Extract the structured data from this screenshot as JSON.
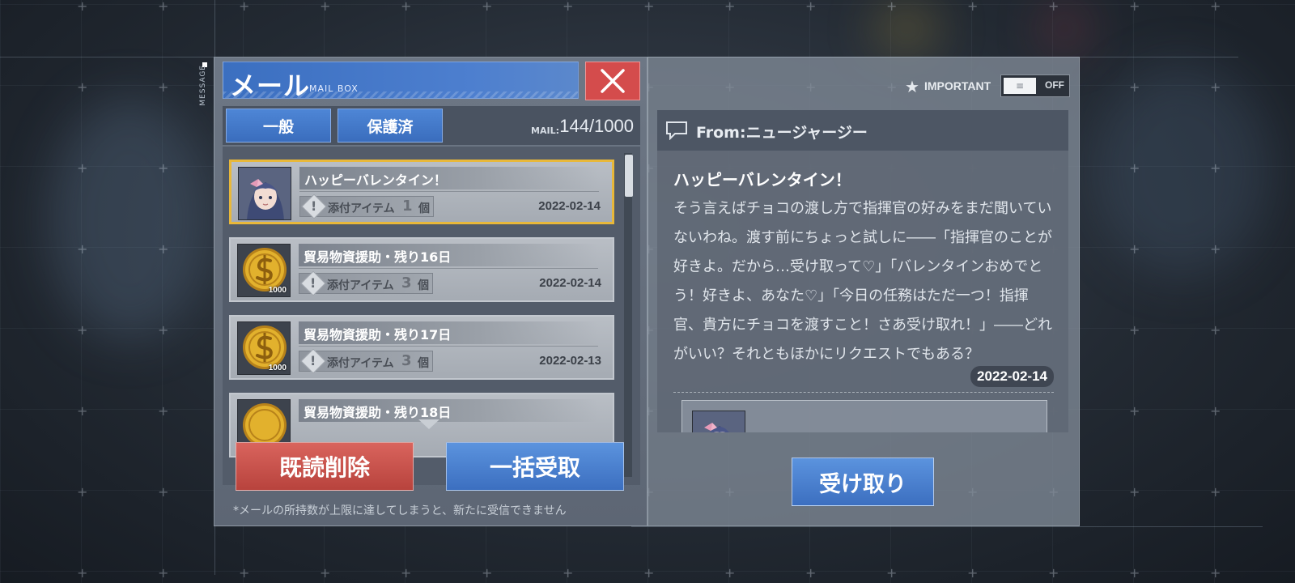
{
  "mailbox": {
    "side_label": "MESSAGE",
    "title": "メール",
    "subtitle": "MAIL BOX",
    "tabs": [
      {
        "label": "一般"
      },
      {
        "label": "保護済"
      }
    ],
    "mail_count_label": "MAIL:",
    "mail_count": "144/1000",
    "items": [
      {
        "title": "ハッピーバレンタイン！",
        "attach_label": "添付アイテム",
        "attach_count": "1",
        "attach_unit": "個",
        "date": "2022-02-14",
        "thumb": "character-portrait",
        "selected": true
      },
      {
        "title": "貿易物資援助・残り16日",
        "attach_label": "添付アイテム",
        "attach_count": "3",
        "attach_unit": "個",
        "date": "2022-02-14",
        "thumb": "gold-coin-1000",
        "coin_value": "1000"
      },
      {
        "title": "貿易物資援助・残り17日",
        "attach_label": "添付アイテム",
        "attach_count": "3",
        "attach_unit": "個",
        "date": "2022-02-13",
        "thumb": "gold-coin-1000",
        "coin_value": "1000"
      },
      {
        "title": "貿易物資援助・残り18日",
        "thumb": "gold-coin"
      }
    ],
    "delete_read_label": "既読削除",
    "receive_all_label": "一括受取",
    "warning_note": "*メールの所持数が上限に達してしまうと、新たに受信できません"
  },
  "detail": {
    "important_label": "IMPORTANT",
    "toggle_state": "OFF",
    "from": "From:ニュージャージー",
    "title": "ハッピーバレンタイン！",
    "body": "そう言えばチョコの渡し方で指揮官の好みをまだ聞いていないわね。渡す前にちょっと試しに――「指揮官のことが好きよ。だから…受け取って♡」「バレンタインおめでとう！好きよ、あなた♡」「今日の任務はただ一つ！指揮官、貴方にチョコを渡すこと！さあ受け取れ！」――どれがいい？それともほかにリクエストでもある？",
    "date": "2022-02-14",
    "receive_label": "受け取り"
  },
  "colors": {
    "accent_blue": "#3b6fc0",
    "close_red": "#d44c4c",
    "selected_border": "#e8b83a",
    "coin_gold": "#d9a521"
  }
}
